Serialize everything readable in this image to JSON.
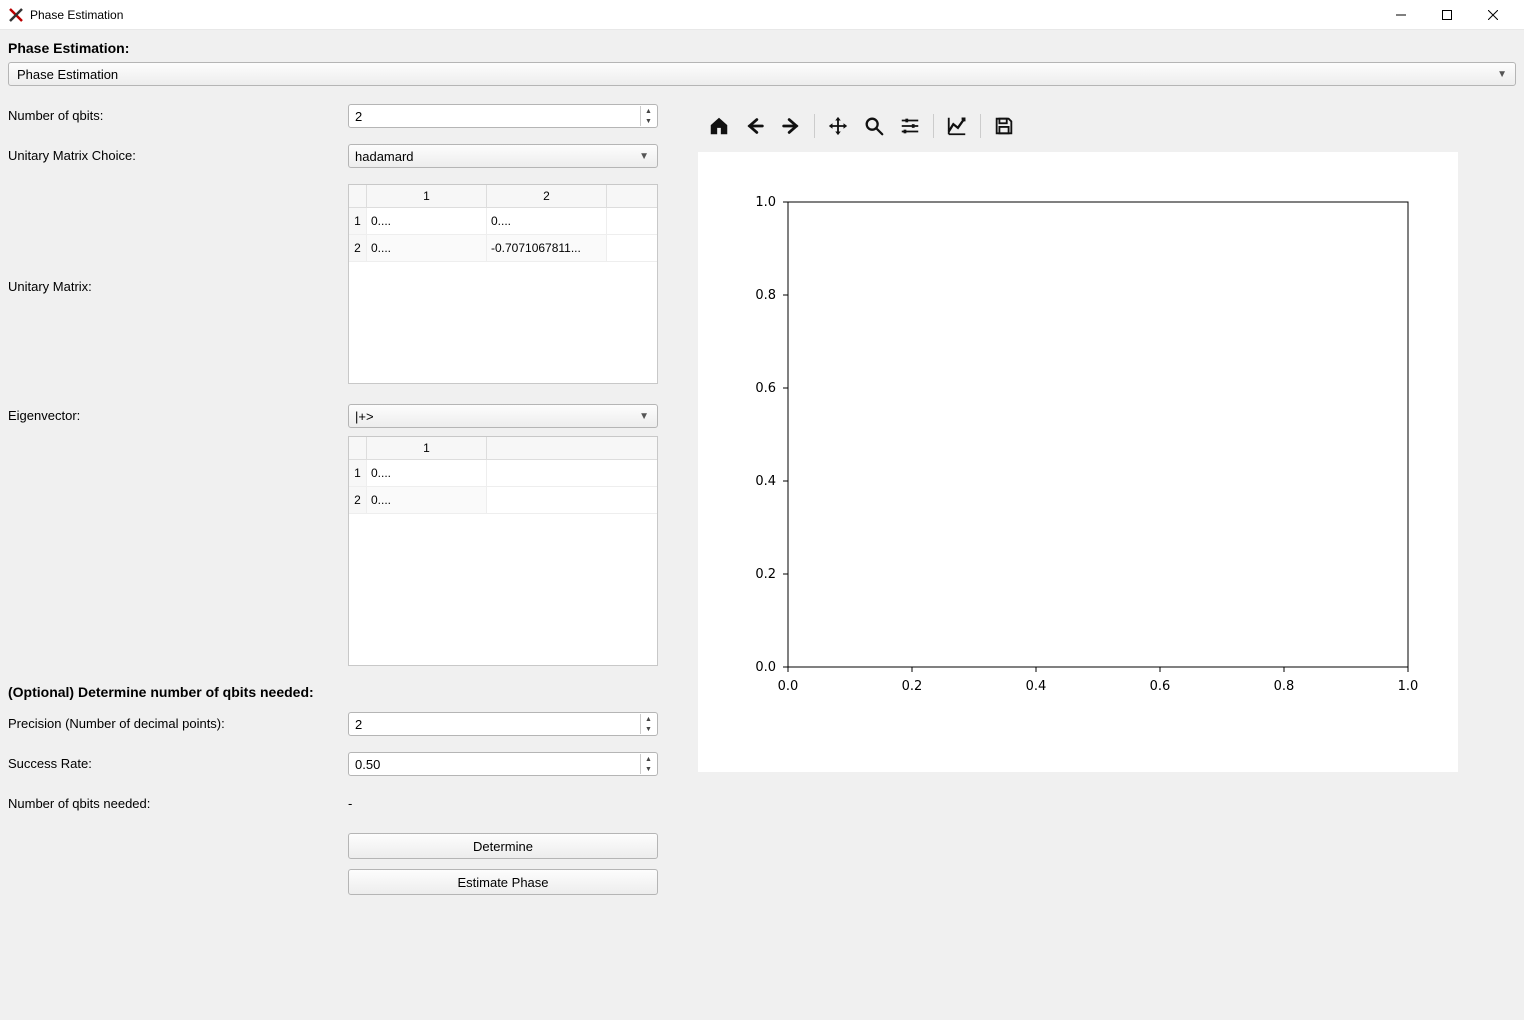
{
  "window": {
    "title": "Phase Estimation"
  },
  "header": {
    "label": "Phase Estimation:",
    "dropdown_value": "Phase Estimation"
  },
  "form": {
    "num_qbits_label": "Number of qbits:",
    "num_qbits_value": "2",
    "unitary_choice_label": "Unitary Matrix Choice:",
    "unitary_choice_value": "hadamard",
    "unitary_matrix_label": "Unitary Matrix:",
    "eigenvector_label": "Eigenvector:",
    "eigenvector_value": "|+>",
    "optional_label": "(Optional) Determine number of qbits needed:",
    "precision_label": "Precision (Number of decimal points):",
    "precision_value": "2",
    "success_label": "Success Rate:",
    "success_value": "0.50",
    "qbits_needed_label": "Number of qbits needed:",
    "qbits_needed_value": "-",
    "determine_label": "Determine",
    "estimate_label": "Estimate Phase"
  },
  "unitary_matrix_grid": {
    "col_headers": [
      "1",
      "2"
    ],
    "rows": [
      {
        "head": "1",
        "cells": [
          "0....",
          "0...."
        ]
      },
      {
        "head": "2",
        "cells": [
          "0....",
          "-0.7071067811..."
        ]
      }
    ]
  },
  "eigenvector_grid": {
    "col_headers": [
      "1"
    ],
    "rows": [
      {
        "head": "1",
        "cells": [
          "0...."
        ]
      },
      {
        "head": "2",
        "cells": [
          "0...."
        ]
      }
    ]
  },
  "chart_data": {
    "type": "scatter",
    "series": [],
    "x_ticks": [
      "0.0",
      "0.2",
      "0.4",
      "0.6",
      "0.8",
      "1.0"
    ],
    "y_ticks": [
      "0.0",
      "0.2",
      "0.4",
      "0.6",
      "0.8",
      "1.0"
    ],
    "xlim": [
      0.0,
      1.0
    ],
    "ylim": [
      0.0,
      1.0
    ],
    "title": "",
    "xlabel": "",
    "ylabel": ""
  }
}
